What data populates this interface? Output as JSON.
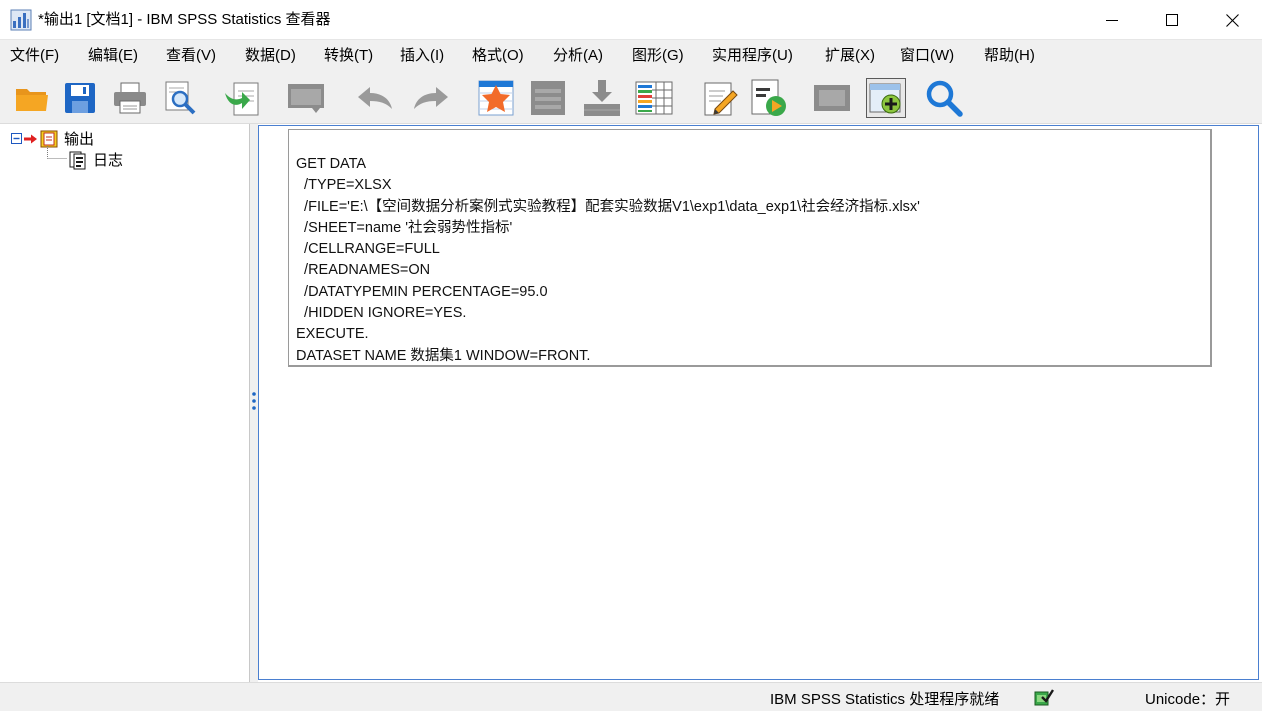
{
  "window": {
    "title": "*输出1 [文档1] - IBM SPSS Statistics 查看器",
    "icons": {
      "app": "spss-app-icon",
      "minimize": "minimize-icon",
      "maximize": "maximize-icon",
      "close": "close-icon"
    }
  },
  "menu": {
    "items": [
      "文件(F)",
      "编辑(E)",
      "查看(V)",
      "数据(D)",
      "转换(T)",
      "插入(I)",
      "格式(O)",
      "分析(A)",
      "图形(G)",
      "实用程序(U)",
      "扩展(X)",
      "窗口(W)",
      "帮助(H)"
    ]
  },
  "toolbar": {
    "tools": [
      {
        "name": "open-folder-icon",
        "enabled": true
      },
      {
        "name": "save-icon",
        "enabled": true
      },
      {
        "name": "print-icon",
        "enabled": true
      },
      {
        "name": "print-preview-icon",
        "enabled": true
      },
      {
        "name": "export-icon",
        "enabled": true
      },
      {
        "name": "recall-dialog-icon",
        "enabled": false
      },
      {
        "name": "undo-icon",
        "enabled": false
      },
      {
        "name": "redo-icon",
        "enabled": false
      },
      {
        "name": "goto-data-icon",
        "enabled": true
      },
      {
        "name": "goto-case-icon",
        "enabled": false
      },
      {
        "name": "goto-variable-icon",
        "enabled": false
      },
      {
        "name": "variables-icon",
        "enabled": true
      },
      {
        "name": "designate-window-icon",
        "enabled": true
      },
      {
        "name": "run-script-icon",
        "enabled": true
      },
      {
        "name": "show-all-icon",
        "enabled": false
      },
      {
        "name": "insert-item-icon",
        "enabled": true
      },
      {
        "name": "search-icon",
        "enabled": true
      }
    ],
    "colors": {
      "star": "#f26b2a",
      "accent_blue": "#1e78d6",
      "folder": "#f5a623",
      "green": "#3aa84a"
    }
  },
  "tree": {
    "root_label": "输出",
    "child_label": "日志",
    "icons": {
      "collapse": "collapse-toggle-icon",
      "arrow": "red-arrow-icon",
      "root": "output-book-icon",
      "child": "log-icon"
    }
  },
  "log": {
    "lines": [
      "GET DATA",
      "  /TYPE=XLSX",
      "  /FILE='E:\\【空间数据分析案例式实验教程】配套实验数据V1\\exp1\\data_exp1\\社会经济指标.xlsx'",
      "  /SHEET=name '社会弱势性指标'",
      "  /CELLRANGE=FULL",
      "  /READNAMES=ON",
      "  /DATATYPEMIN PERCENTAGE=95.0",
      "  /HIDDEN IGNORE=YES.",
      "EXECUTE.",
      "DATASET NAME 数据集1 WINDOW=FRONT."
    ]
  },
  "status": {
    "processor": "IBM SPSS Statistics 处理程序就绪",
    "encoding": "Unicode：开",
    "icon": "processor-ready-icon"
  }
}
